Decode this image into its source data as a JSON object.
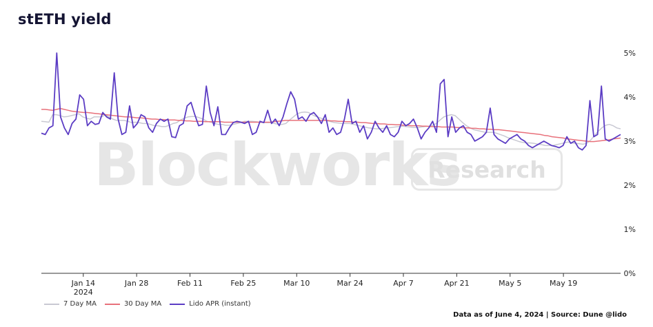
{
  "header": {
    "title": "stETH yield"
  },
  "watermark": {
    "brand": "Blockworks",
    "tag": "Research"
  },
  "footer": {
    "source": "Data as of June 4, 2024 | Source: Dune @lido"
  },
  "colors": {
    "ma7": "#c8c8d2",
    "ma30": "#e8707a",
    "apr": "#5b3cc4"
  },
  "chart_data": {
    "type": "line",
    "title": "stETH yield",
    "x_tick_labels": [
      "Jan 14",
      "Jan 28",
      "Feb 11",
      "Feb 25",
      "Mar 10",
      "Mar 24",
      "Apr 7",
      "Apr 21",
      "May 5",
      "May 19"
    ],
    "x_tick_sublabel": "2024",
    "y_tick_labels": [
      "0%",
      "1%",
      "2%",
      "3%",
      "4%",
      "5%"
    ],
    "ylim": [
      0,
      5
    ],
    "y_axis_side": "right",
    "grid": false,
    "legend": "bottom-left",
    "x_start": "2024-01-03",
    "x_end": "2024-06-03",
    "series": [
      {
        "name": "7 Day MA",
        "color": "#c8c8d2",
        "values": [
          3.45,
          3.44,
          3.43,
          3.6,
          3.6,
          3.58,
          3.55,
          3.56,
          3.58,
          3.6,
          3.62,
          3.55,
          3.52,
          3.5,
          3.55,
          3.55,
          3.55,
          3.6,
          3.55,
          3.5,
          3.47,
          3.47,
          3.47,
          3.45,
          3.42,
          3.43,
          3.42,
          3.4,
          3.4,
          3.38,
          3.35,
          3.35,
          3.33,
          3.33,
          3.36,
          3.4,
          3.42,
          3.48,
          3.52,
          3.55,
          3.56,
          3.56,
          3.53,
          3.5,
          3.45,
          3.43,
          3.4,
          3.38,
          3.38,
          3.36,
          3.36,
          3.38,
          3.4,
          3.42,
          3.45,
          3.45,
          3.45,
          3.44,
          3.43,
          3.42,
          3.42,
          3.42,
          3.4,
          3.38,
          3.38,
          3.4,
          3.48,
          3.55,
          3.62,
          3.65,
          3.66,
          3.65,
          3.6,
          3.56,
          3.53,
          3.5,
          3.46,
          3.44,
          3.42,
          3.41,
          3.4,
          3.4,
          3.4,
          3.38,
          3.36,
          3.34,
          3.32,
          3.3,
          3.29,
          3.28,
          3.28,
          3.29,
          3.3,
          3.31,
          3.32,
          3.33,
          3.34,
          3.33,
          3.32,
          3.31,
          3.31,
          3.32,
          3.33,
          3.34,
          3.36,
          3.4,
          3.48,
          3.55,
          3.58,
          3.6,
          3.58,
          3.5,
          3.42,
          3.35,
          3.3,
          3.26,
          3.24,
          3.22,
          3.2,
          3.2,
          3.2,
          3.18,
          3.15,
          3.12,
          3.08,
          3.05,
          3.02,
          2.99,
          2.97,
          2.96,
          2.96,
          2.95,
          2.93,
          2.92,
          2.9,
          2.9,
          2.9,
          2.92,
          2.94,
          2.96,
          2.98,
          2.96,
          2.95,
          2.94,
          2.93,
          2.95,
          3.02,
          3.12,
          3.22,
          3.3,
          3.36,
          3.38,
          3.35,
          3.3,
          3.28
        ]
      },
      {
        "name": "30 Day MA",
        "color": "#e8707a",
        "values": [
          3.72,
          3.72,
          3.71,
          3.7,
          3.72,
          3.74,
          3.72,
          3.7,
          3.68,
          3.67,
          3.66,
          3.65,
          3.65,
          3.64,
          3.63,
          3.62,
          3.61,
          3.6,
          3.59,
          3.58,
          3.57,
          3.56,
          3.55,
          3.55,
          3.54,
          3.53,
          3.53,
          3.52,
          3.51,
          3.5,
          3.5,
          3.49,
          3.49,
          3.48,
          3.48,
          3.48,
          3.47,
          3.47,
          3.46,
          3.46,
          3.45,
          3.45,
          3.45,
          3.44,
          3.44,
          3.44,
          3.44,
          3.44,
          3.43,
          3.43,
          3.43,
          3.43,
          3.43,
          3.43,
          3.43,
          3.43,
          3.43,
          3.43,
          3.43,
          3.43,
          3.43,
          3.44,
          3.45,
          3.46,
          3.47,
          3.47,
          3.47,
          3.47,
          3.47,
          3.47,
          3.47,
          3.47,
          3.47,
          3.47,
          3.47,
          3.47,
          3.46,
          3.46,
          3.45,
          3.45,
          3.44,
          3.44,
          3.43,
          3.43,
          3.42,
          3.42,
          3.41,
          3.4,
          3.4,
          3.39,
          3.39,
          3.38,
          3.38,
          3.37,
          3.37,
          3.36,
          3.36,
          3.35,
          3.35,
          3.35,
          3.34,
          3.34,
          3.33,
          3.33,
          3.33,
          3.32,
          3.32,
          3.32,
          3.32,
          3.31,
          3.31,
          3.3,
          3.3,
          3.29,
          3.29,
          3.28,
          3.28,
          3.27,
          3.27,
          3.26,
          3.26,
          3.25,
          3.24,
          3.23,
          3.22,
          3.21,
          3.2,
          3.19,
          3.18,
          3.17,
          3.16,
          3.15,
          3.13,
          3.12,
          3.1,
          3.09,
          3.08,
          3.07,
          3.05,
          3.04,
          3.03,
          3.02,
          3.01,
          3.0,
          2.99,
          2.99,
          3.0,
          3.01,
          3.02,
          3.03,
          3.05,
          3.06,
          3.07
        ]
      },
      {
        "name": "Lido APR (instant)",
        "color": "#5b3cc4",
        "values": [
          3.18,
          3.15,
          3.3,
          3.35,
          5.0,
          3.55,
          3.3,
          3.15,
          3.4,
          3.5,
          4.05,
          3.95,
          3.35,
          3.45,
          3.38,
          3.4,
          3.65,
          3.55,
          3.5,
          4.55,
          3.5,
          3.15,
          3.2,
          3.8,
          3.3,
          3.4,
          3.6,
          3.55,
          3.3,
          3.2,
          3.4,
          3.5,
          3.45,
          3.5,
          3.1,
          3.08,
          3.35,
          3.4,
          3.8,
          3.88,
          3.6,
          3.35,
          3.38,
          4.25,
          3.65,
          3.35,
          3.78,
          3.15,
          3.15,
          3.3,
          3.42,
          3.45,
          3.43,
          3.4,
          3.45,
          3.15,
          3.2,
          3.45,
          3.42,
          3.7,
          3.4,
          3.5,
          3.35,
          3.55,
          3.85,
          4.12,
          3.95,
          3.5,
          3.55,
          3.45,
          3.6,
          3.65,
          3.55,
          3.4,
          3.6,
          3.2,
          3.3,
          3.15,
          3.2,
          3.5,
          3.95,
          3.4,
          3.45,
          3.2,
          3.35,
          3.05,
          3.2,
          3.45,
          3.3,
          3.2,
          3.35,
          3.15,
          3.1,
          3.2,
          3.45,
          3.35,
          3.4,
          3.5,
          3.3,
          3.05,
          3.2,
          3.3,
          3.45,
          3.2,
          4.3,
          4.4,
          3.1,
          3.55,
          3.2,
          3.3,
          3.35,
          3.2,
          3.15,
          3.0,
          3.05,
          3.1,
          3.2,
          3.75,
          3.15,
          3.05,
          3.0,
          2.95,
          3.05,
          3.1,
          3.15,
          3.05,
          3.0,
          2.9,
          2.85,
          2.9,
          2.95,
          3.0,
          2.95,
          2.9,
          2.88,
          2.85,
          2.9,
          3.1,
          2.95,
          3.0,
          2.85,
          2.8,
          2.9,
          3.92,
          3.1,
          3.15,
          4.25,
          3.05,
          3.0,
          3.05,
          3.1,
          3.15
        ]
      }
    ]
  }
}
